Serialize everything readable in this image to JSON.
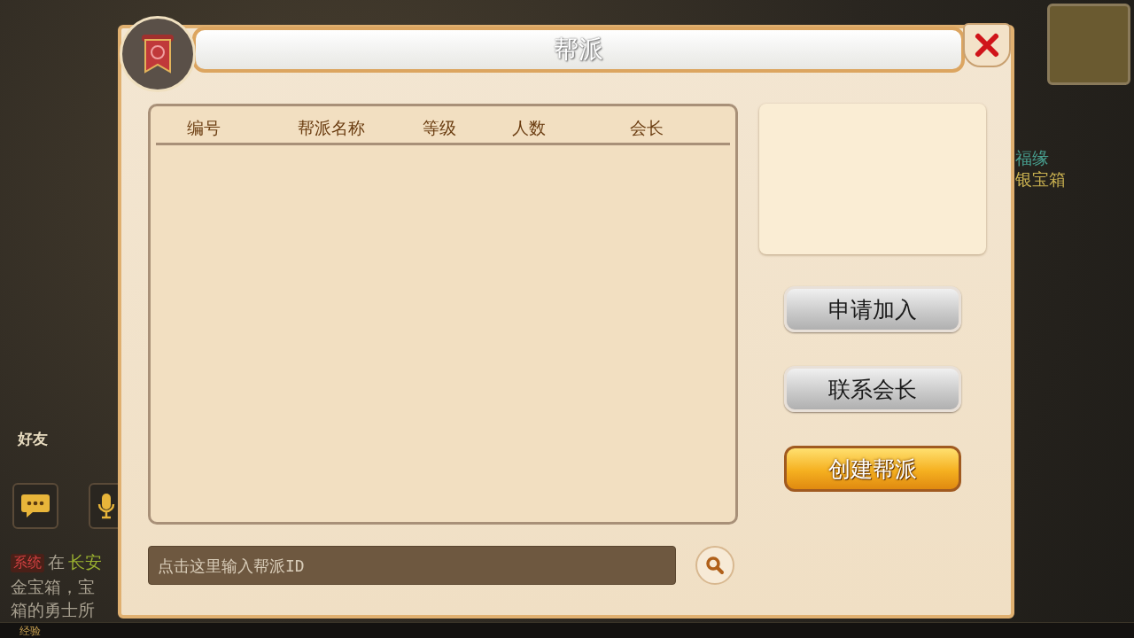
{
  "background": {
    "friends_label": "好友",
    "chat_lines": [
      {
        "kind": "tag",
        "text": "系统"
      },
      {
        "kind": "plain",
        "text": "在"
      },
      {
        "kind": "place",
        "text": "长安"
      }
    ],
    "chat_more": [
      "金宝箱，宝",
      "箱的勇士所"
    ],
    "exp_label": "经验",
    "side_texts": [
      "福缘",
      "银宝箱"
    ]
  },
  "dialog": {
    "title": "帮派",
    "table": {
      "columns": [
        "编号",
        "帮派名称",
        "等级",
        "人数",
        "会长"
      ]
    },
    "search": {
      "placeholder": "点击这里输入帮派ID"
    },
    "buttons": [
      {
        "label": "申请加入",
        "kind": "normal"
      },
      {
        "label": "联系会长",
        "kind": "normal"
      },
      {
        "label": "创建帮派",
        "kind": "primary"
      }
    ]
  }
}
